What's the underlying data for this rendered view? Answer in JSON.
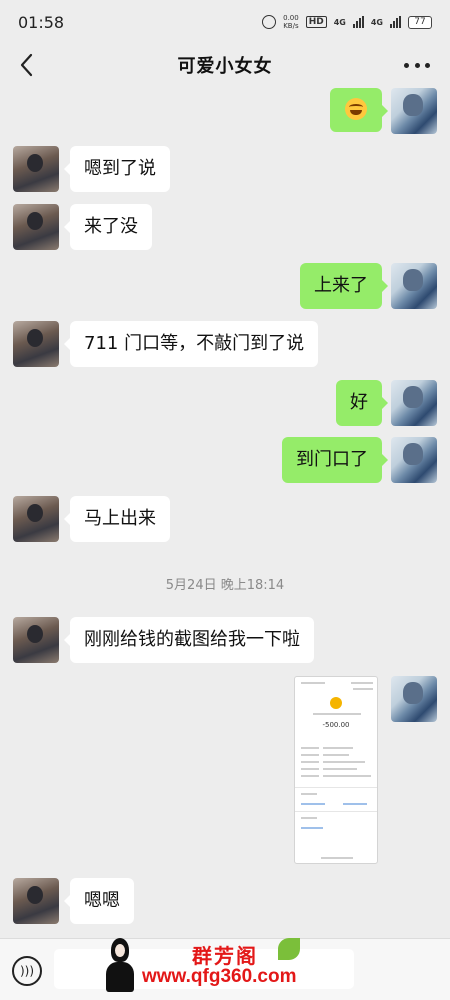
{
  "status_bar": {
    "time": "01:58",
    "net_speed_value": "0.00",
    "net_speed_unit": "KB/s",
    "hd_label": "HD",
    "network_1": "4G",
    "network_2": "4G",
    "battery": "77"
  },
  "header": {
    "title": "可爱小女女"
  },
  "messages": [
    {
      "side": "out",
      "kind": "emoji",
      "icon": "laughing-crying-emoji"
    },
    {
      "side": "in",
      "text": "嗯到了说"
    },
    {
      "side": "in",
      "text": "来了没"
    },
    {
      "side": "out",
      "text": "上来了"
    },
    {
      "side": "in",
      "text": "711 门口等，不敲门到了说"
    },
    {
      "side": "out",
      "text": "好"
    },
    {
      "side": "out",
      "text": "到门口了"
    },
    {
      "side": "in",
      "text": "马上出来"
    },
    {
      "side": "in",
      "text": "刚刚给钱的截图给我一下啦"
    },
    {
      "side": "out",
      "kind": "image",
      "amount": "-500.00"
    },
    {
      "side": "in",
      "text": "嗯嗯"
    }
  ],
  "timestamp": "5月24日 晚上18:14",
  "input_bar": {
    "voice_icon": "voice-icon",
    "placeholder": ""
  },
  "watermark": {
    "brand": "群芳阁",
    "url": "www.qfg360.com"
  },
  "colors": {
    "background": "#ededed",
    "outgoing_bubble": "#95ec69",
    "incoming_bubble": "#ffffff",
    "watermark": "#e31818"
  }
}
